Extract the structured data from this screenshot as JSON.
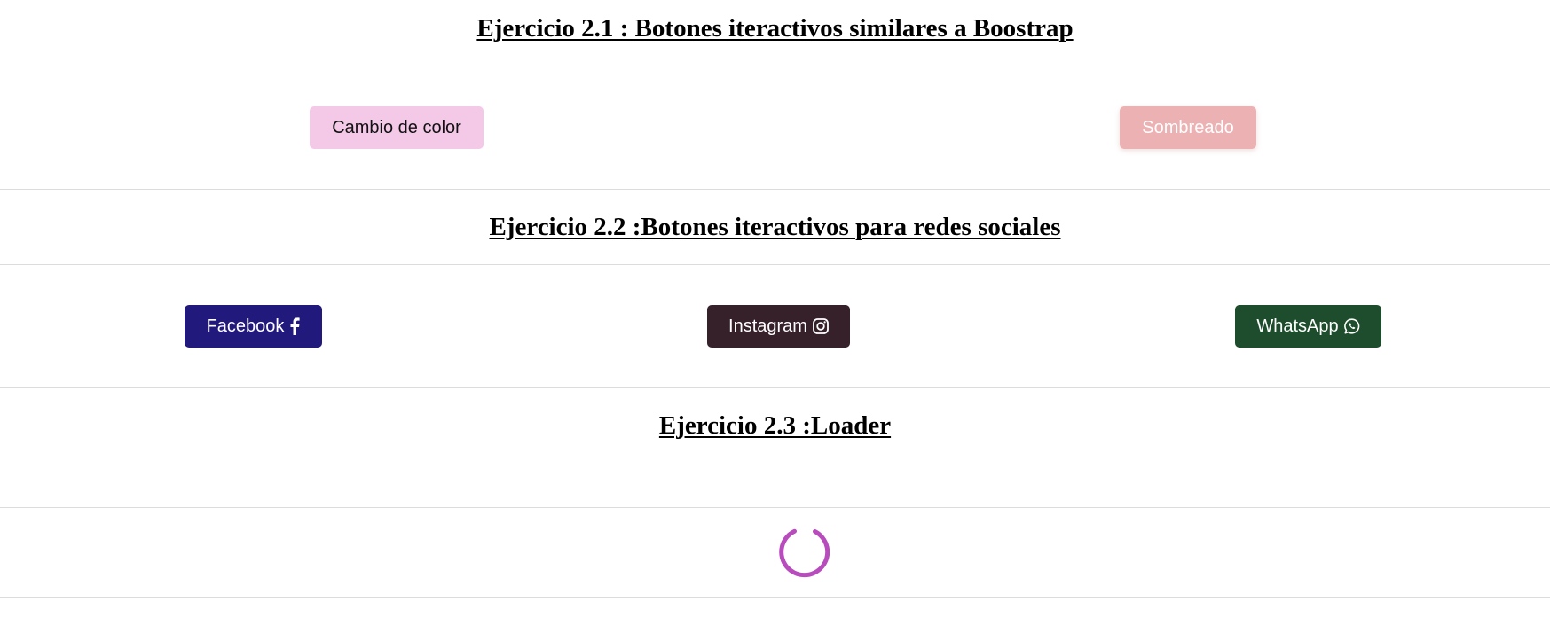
{
  "sections": {
    "ex1": {
      "title": "Ejercicio 2.1 : Botones iteractivos similares a Boostrap"
    },
    "ex2": {
      "title": "Ejercicio 2.2 :Botones iteractivos para redes sociales"
    },
    "ex3": {
      "title": "Ejercicio 2.3 :Loader"
    }
  },
  "buttons": {
    "color": {
      "label": "Cambio de color",
      "bg": "#f3c9e7"
    },
    "shadow": {
      "label": "Sombreado",
      "bg": "#ecb2b3"
    },
    "facebook": {
      "label": "Facebook",
      "bg": "#21197c",
      "icon": "facebook-icon"
    },
    "instagram": {
      "label": "Instagram",
      "bg": "#36202a",
      "icon": "instagram-icon"
    },
    "whatsapp": {
      "label": "WhatsApp",
      "bg": "#1d4d2c",
      "icon": "whatsapp-icon"
    }
  },
  "loader": {
    "color": "#b84cbc",
    "icon": "spinner-icon"
  }
}
